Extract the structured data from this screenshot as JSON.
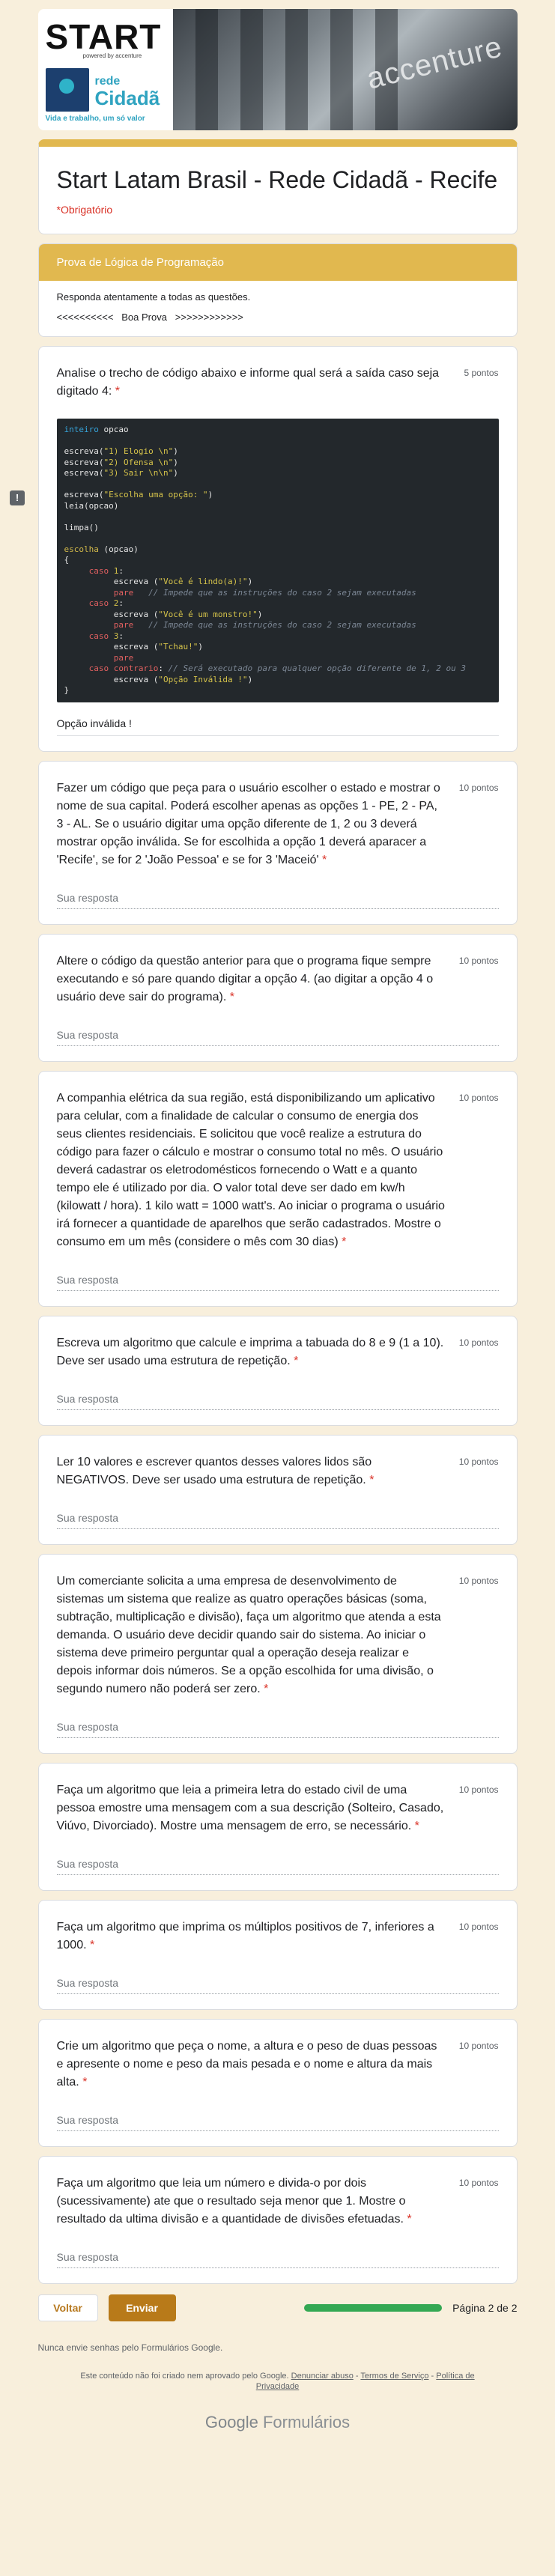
{
  "banner": {
    "logo_start": "START",
    "powered_by": "powered by accenture",
    "rede_line1": "rede",
    "rede_line2": "Cidadã",
    "rede_tagline": "Vida e trabalho, um só valor",
    "building_sign": "accenture"
  },
  "form": {
    "title": "Start Latam Brasil - Rede Cidadã - Recife",
    "required_note": "*Obrigatório"
  },
  "section": {
    "title": "Prova de Lógica de Programação",
    "description": "Responda atentamente a todas as questões.",
    "wish": "<<<<<<<<<<   Boa Prova   >>>>>>>>>>>>"
  },
  "questions": [
    {
      "text": "Analise o trecho de código abaixo e informe qual será a saída caso seja digitado 4:",
      "required": "*",
      "points": "5 pontos",
      "answer_value": "Opção inválida !"
    },
    {
      "text": "Fazer um código que peça para o usuário escolher o estado e mostrar o nome de sua capital. Poderá escolher apenas as opções 1 - PE, 2 - PA, 3 - AL. Se o usuário digitar uma opção diferente de 1, 2 ou 3 deverá mostrar opção inválida. Se for escolhida a opção 1 deverá aparacer a 'Recife', se for 2 'João Pessoa' e se for 3 'Maceió'",
      "required": "*",
      "points": "10 pontos",
      "placeholder": "Sua resposta"
    },
    {
      "text": "Altere o código da questão anterior para que o programa fique sempre executando e só pare quando digitar a opção 4. (ao digitar a opção 4 o usuário deve sair do programa).",
      "required": "*",
      "points": "10 pontos",
      "placeholder": "Sua resposta"
    },
    {
      "text": "A companhia elétrica da sua região, está disponibilizando um aplicativo para celular, com a finalidade de calcular o consumo de energia dos seus clientes residenciais. E solicitou que você realize a estrutura do código para fazer o cálculo e mostrar o consumo total no mês. O usuário deverá cadastrar os eletrodomésticos fornecendo o Watt e a quanto tempo ele é utilizado por dia. O valor total deve ser dado em kw/h (kilowatt / hora). 1 kilo watt = 1000 watt's. Ao iniciar o programa o usuário irá fornecer a quantidade de aparelhos que serão cadastrados. Mostre o consumo em um mês (considere o mês com 30 dias)",
      "required": "*",
      "points": "10 pontos",
      "placeholder": "Sua resposta"
    },
    {
      "text": "Escreva um algoritmo que calcule e imprima a tabuada do 8 e 9 (1 a 10). Deve ser usado uma estrutura de repetição.",
      "required": "*",
      "points": "10 pontos",
      "placeholder": "Sua resposta"
    },
    {
      "text": "Ler 10 valores e escrever quantos desses valores lidos são NEGATIVOS. Deve ser usado uma estrutura de repetição.",
      "required": "*",
      "points": "10 pontos",
      "placeholder": "Sua resposta"
    },
    {
      "text": "Um comerciante solicita a uma empresa de desenvolvimento de sistemas um sistema que realize as quatro operações básicas (soma, subtração, multiplicação e divisão), faça um algoritmo que atenda a esta demanda. O usuário deve decidir quando sair do sistema. Ao iniciar o sistema deve primeiro perguntar qual a operação deseja realizar e depois informar dois números. Se a opção escolhida for uma divisão, o segundo numero não poderá ser zero.",
      "required": "*",
      "points": "10 pontos",
      "placeholder": "Sua resposta"
    },
    {
      "text": "Faça um algoritmo que leia a primeira letra do estado civil de uma pessoa emostre uma mensagem com a sua descrição (Solteiro, Casado, Viúvo, Divorciado). Mostre uma mensagem de erro, se necessário.",
      "required": "*",
      "points": "10 pontos",
      "placeholder": "Sua resposta"
    },
    {
      "text": "Faça um algoritmo que imprima os múltiplos positivos de 7, inferiores a 1000.",
      "required": "*",
      "points": "10 pontos",
      "placeholder": "Sua resposta"
    },
    {
      "text": "Crie um algoritmo que peça o nome, a altura e o peso de duas pessoas e apresente o nome e peso da mais pesada e o nome e altura da mais alta.",
      "required": "*",
      "points": "10 pontos",
      "placeholder": "Sua resposta"
    },
    {
      "text": "Faça um algoritmo que leia um número e divida-o por dois (sucessivamente) ate que o resultado seja menor que 1. Mostre o resultado da ultima divisão e a quantidade de divisões efetuadas.",
      "required": "*",
      "points": "10 pontos",
      "placeholder": "Sua resposta"
    }
  ],
  "nav": {
    "back_label": "Voltar",
    "submit_label": "Enviar",
    "progress_fraction": 1.0,
    "page_label": "Página 2 de 2"
  },
  "footer": {
    "never_submit": "Nunca envie senhas pelo Formulários Google.",
    "disclaimer_text": "Este conteúdo não foi criado nem aprovado pelo Google.",
    "report_abuse": "Denunciar abuso",
    "sep1": " - ",
    "terms": "Termos de Serviço",
    "sep2": " - ",
    "privacy": "Política de Privacidade",
    "brand_google": "Google",
    "brand_forms": "Formulários"
  },
  "colors": {
    "theme": "#e1b84f",
    "background": "#f8efdc",
    "submit": "#b87a19",
    "required": "#d93025",
    "progress": "#34a853"
  }
}
